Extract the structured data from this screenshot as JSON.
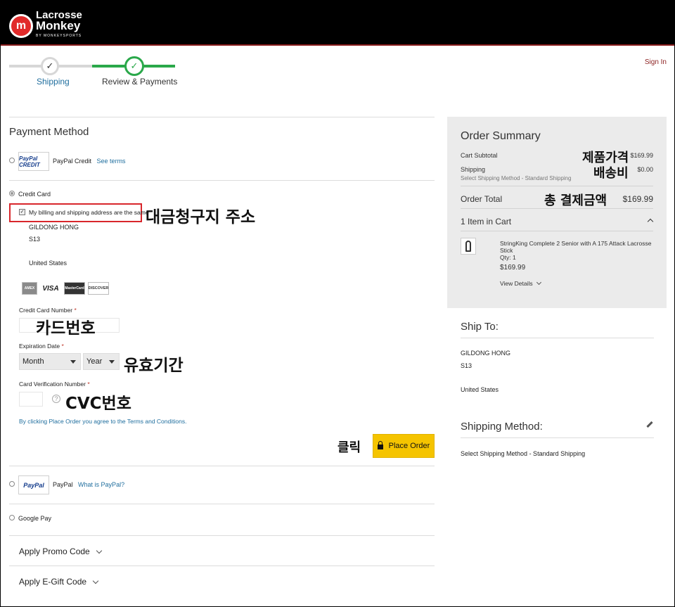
{
  "header": {
    "logo_line1": "Lacrosse",
    "logo_line2": "Monkey",
    "logo_sub": "BY MONKEYSPORTS",
    "logo_mark": "m",
    "signin": "Sign In"
  },
  "steps": [
    {
      "label": "Shipping",
      "state": "done"
    },
    {
      "label": "Review & Payments",
      "state": "current"
    }
  ],
  "payment": {
    "title": "Payment Method",
    "paypal_credit": {
      "logo": "PayPal CREDIT",
      "label": "PayPal Credit",
      "link": "See terms"
    },
    "credit_card": {
      "label": "Credit Card",
      "same_address": "My billing and shipping address are the same",
      "address": [
        "GILDONG HONG",
        "S13",
        "United States"
      ],
      "cards": [
        "AMEX",
        "VISA",
        "MasterCard",
        "DISCOVER"
      ],
      "card_number_label": "Credit Card Number",
      "expiration_label": "Expiration Date",
      "month": "Month",
      "year": "Year",
      "cvv_label": "Card Verification Number",
      "required_mark": "*",
      "help": "?",
      "agree": "By clicking Place Order you agree to the Terms and Conditions.",
      "place_order": "Place Order"
    },
    "paypal": {
      "logo": "PayPal",
      "label": "PayPal",
      "link": "What is PayPal?"
    },
    "google_pay": {
      "label": "Google Pay"
    },
    "promo": "Apply Promo Code",
    "egift": "Apply E-Gift Code"
  },
  "annotations": {
    "billing": "대금청구지 주소",
    "card_number": "카드번호",
    "expiry": "유효기간",
    "cvc": "CVC번호",
    "click": "클릭",
    "subtotal": "제품가격",
    "shipping": "배송비",
    "total": "총 결제금액"
  },
  "summary": {
    "title": "Order Summary",
    "subtotal_label": "Cart Subtotal",
    "subtotal_value": "$169.99",
    "shipping_label": "Shipping",
    "shipping_value": "$0.00",
    "shipping_method": "Select Shipping Method - Standard Shipping",
    "total_label": "Order Total",
    "total_value": "$169.99",
    "items_label": "1 Item in Cart",
    "item": {
      "name": "StringKing Complete 2 Senior with A 175 Attack Lacrosse Stick",
      "qty": "Qty: 1",
      "price": "$169.99",
      "details": "View Details"
    }
  },
  "ship_to": {
    "title": "Ship To:",
    "lines": [
      "GILDONG HONG",
      "S13",
      "United States"
    ]
  },
  "shipping_method": {
    "title": "Shipping Method:",
    "value": "Select Shipping Method - Standard Shipping"
  }
}
